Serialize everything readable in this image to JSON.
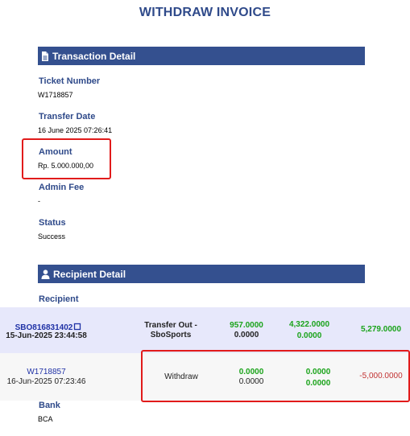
{
  "title": "WITHDRAW INVOICE",
  "transaction_section": {
    "heading": "Transaction Detail",
    "ticket_label": "Ticket Number",
    "ticket_value": "W1718857",
    "transfer_date_label": "Transfer Date",
    "transfer_date_value": "16 June 2025 07:26:41",
    "amount_label": "Amount",
    "amount_value": "Rp. 5.000.000,00",
    "admin_fee_label": "Admin Fee",
    "admin_fee_value": "-",
    "status_label": "Status",
    "status_value": "Success"
  },
  "recipient_section": {
    "heading": "Recipient Detail",
    "recipient_label": "Recipient",
    "bank_label": "Bank",
    "bank_value": "BCA"
  },
  "rows": [
    {
      "ref": "SBO816831402",
      "datetime": "15-Jun-2025 23:44:58",
      "type_line1": "Transfer Out -",
      "type_line2": "SboSports",
      "col1_top": "957.0000",
      "col1_bottom": "0.0000",
      "col2_top": "4,322.0000",
      "col2_bottom": "0.0000",
      "balance": "5,279.0000"
    },
    {
      "ref": "W1718857",
      "datetime": "16-Jun-2025 07:23:46",
      "type_line1": "Withdraw",
      "col1_top": "0.0000",
      "col1_bottom": "0.0000",
      "col2_top": "0.0000",
      "col2_bottom": "0.0000",
      "balance": "-5,000.0000"
    }
  ],
  "colors": {
    "header_bar": "#34508f",
    "title": "#2f4a8a",
    "highlight_box": "#e11b1b",
    "positive": "#1aa31a",
    "negative": "#c23232"
  }
}
